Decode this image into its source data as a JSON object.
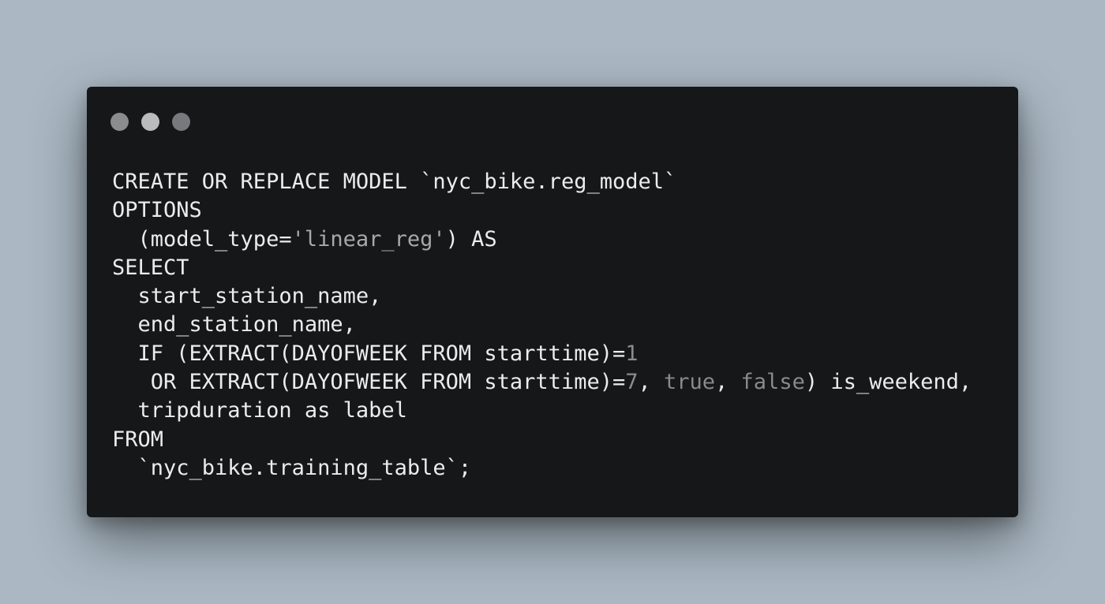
{
  "window": {
    "background": "#151718",
    "dots": [
      {
        "name": "close-dot",
        "color": "#8a8c8e"
      },
      {
        "name": "minimize-dot",
        "color": "#b9bbbd"
      },
      {
        "name": "maximize-dot",
        "color": "#777a7c"
      }
    ]
  },
  "code": {
    "language": "sql",
    "lines": [
      [
        {
          "t": "CREATE OR REPLACE MODEL `nyc_bike.reg_model`",
          "k": "plain"
        }
      ],
      [
        {
          "t": "OPTIONS",
          "k": "plain"
        }
      ],
      [
        {
          "t": "  (model_type=",
          "k": "plain"
        },
        {
          "t": "'linear_reg'",
          "k": "string"
        },
        {
          "t": ") AS",
          "k": "plain"
        }
      ],
      [
        {
          "t": "SELECT",
          "k": "plain"
        }
      ],
      [
        {
          "t": "  start_station_name,",
          "k": "plain"
        }
      ],
      [
        {
          "t": "  end_station_name,",
          "k": "plain"
        }
      ],
      [
        {
          "t": "  IF (EXTRACT(DAYOFWEEK FROM starttime)=",
          "k": "plain"
        },
        {
          "t": "1",
          "k": "number"
        }
      ],
      [
        {
          "t": "   OR EXTRACT(DAYOFWEEK FROM starttime)=",
          "k": "plain"
        },
        {
          "t": "7",
          "k": "number"
        },
        {
          "t": ", ",
          "k": "plain"
        },
        {
          "t": "true",
          "k": "bool"
        },
        {
          "t": ", ",
          "k": "plain"
        },
        {
          "t": "false",
          "k": "bool"
        },
        {
          "t": ") is_weekend,",
          "k": "plain"
        }
      ],
      [
        {
          "t": "  tripduration as label",
          "k": "plain"
        }
      ],
      [
        {
          "t": "FROM",
          "k": "plain"
        }
      ],
      [
        {
          "t": "  `nyc_bike.training_table`;",
          "k": "plain"
        }
      ]
    ]
  }
}
